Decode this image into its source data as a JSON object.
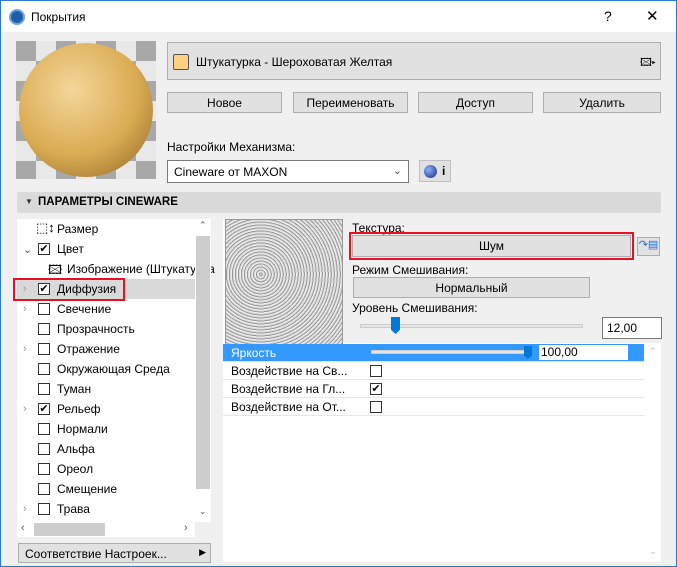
{
  "window": {
    "title": "Покрытия",
    "help": "?",
    "close": "✕"
  },
  "material": {
    "name": "Штукатурка - Шероховатая Желтая",
    "swatch_color": "#fdd083"
  },
  "buttons": {
    "new": "Новое",
    "rename": "Переименовать",
    "access": "Доступ",
    "delete": "Удалить"
  },
  "engine": {
    "label": "Настройки Механизма:",
    "value": "Cineware от MAXON",
    "info": "i"
  },
  "section": {
    "title": "ПАРАМЕТРЫ CINEWARE"
  },
  "tree": [
    {
      "label": "Размер",
      "checked": null,
      "expander": ""
    },
    {
      "label": "Цвет",
      "checked": true,
      "expander": "v"
    },
    {
      "label": "Изображение (Штукатурка",
      "checked": null,
      "expander": ""
    },
    {
      "label": "Диффузия",
      "checked": true,
      "expander": ">",
      "selected": true
    },
    {
      "label": "Свечение",
      "checked": false,
      "expander": ">"
    },
    {
      "label": "Прозрачность",
      "checked": false,
      "expander": ""
    },
    {
      "label": "Отражение",
      "checked": false,
      "expander": ">"
    },
    {
      "label": "Окружающая Среда",
      "checked": false,
      "expander": ""
    },
    {
      "label": "Туман",
      "checked": false,
      "expander": ""
    },
    {
      "label": "Рельеф",
      "checked": true,
      "expander": ">"
    },
    {
      "label": "Нормали",
      "checked": false,
      "expander": ""
    },
    {
      "label": "Альфа",
      "checked": false,
      "expander": ""
    },
    {
      "label": "Ореол",
      "checked": false,
      "expander": ""
    },
    {
      "label": "Смещение",
      "checked": false,
      "expander": ""
    },
    {
      "label": "Трава",
      "checked": false,
      "expander": ">"
    }
  ],
  "match_settings": "Соответствие Настроек...",
  "texture": {
    "label": "Текстура:",
    "value": "Шум"
  },
  "blend_mode": {
    "label": "Режим Смешивания:",
    "value": "Нормальный"
  },
  "blend_level": {
    "label": "Уровень Смешивания:",
    "value": "12,00",
    "fraction": 0.12
  },
  "params": [
    {
      "label": "Яркость",
      "value": "100,00",
      "fraction": 1.0
    },
    {
      "label": "Воздействие на Св...",
      "checked": false
    },
    {
      "label": "Воздействие на Гл...",
      "checked": true
    },
    {
      "label": "Воздействие на От...",
      "checked": false
    }
  ],
  "colors": {
    "accent": "#3399ff",
    "highlight": "#e81123"
  }
}
